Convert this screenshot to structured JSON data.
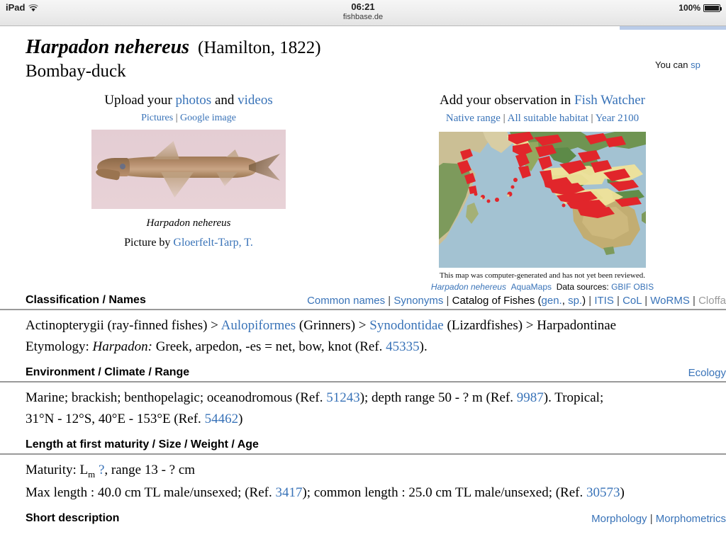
{
  "status_bar": {
    "device": "iPad",
    "wifi_icon": "wifi-icon",
    "time": "06:21",
    "page_domain": "fishbase.de",
    "battery_percent": "100%",
    "battery_icon": "battery-full-icon"
  },
  "notice": {
    "text": "You can sp"
  },
  "header": {
    "scientific_name": "Harpadon nehereus",
    "authority": "(Hamilton, 1822)",
    "common_name": "Bombay-duck"
  },
  "photo_panel": {
    "upload_prefix": "Upload your ",
    "photos_link": "photos",
    "upload_middle": " and ",
    "videos_link": "videos",
    "pictures_link": "Pictures",
    "separator": " | ",
    "google_image_link": "Google image",
    "caption": "Harpadon nehereus",
    "picture_by_prefix": "Picture by ",
    "picture_by_link": "Gloerfelt-Tarp, T."
  },
  "map_panel": {
    "observation_prefix": "Add your observation in ",
    "fish_watcher_link": "Fish Watcher",
    "native_range_link": "Native range",
    "all_habitat_link": "All suitable habitat",
    "year_link": "Year 2100",
    "separator": " | ",
    "map_note": "This map was computer-generated and has not yet been reviewed.",
    "species_link": "Harpadon nehereus",
    "aquamaps_link": "AquaMaps",
    "data_sources_label": "Data sources: ",
    "gbif_obis_link": "GBIF OBIS"
  },
  "sections": [
    {
      "title": "Classification / Names",
      "right_links": [
        {
          "text": "Common names",
          "type": "link"
        },
        {
          "text": " | ",
          "type": "sep"
        },
        {
          "text": "Synonyms",
          "type": "link"
        },
        {
          "text": " | ",
          "type": "sep"
        },
        {
          "text": "Catalog of Fishes ",
          "type": "text"
        },
        {
          "text": "(",
          "type": "text"
        },
        {
          "text": "gen.",
          "type": "link"
        },
        {
          "text": ", ",
          "type": "text"
        },
        {
          "text": "sp.",
          "type": "link"
        },
        {
          "text": ")",
          "type": "text"
        },
        {
          "text": " | ",
          "type": "sep"
        },
        {
          "text": "ITIS",
          "type": "link"
        },
        {
          "text": " | ",
          "type": "sep"
        },
        {
          "text": "CoL",
          "type": "link"
        },
        {
          "text": " | ",
          "type": "sep"
        },
        {
          "text": "WoRMS",
          "type": "link"
        },
        {
          "text": " | ",
          "type": "sep"
        },
        {
          "text": "Cloffa",
          "type": "gray"
        }
      ],
      "lines": [
        [
          {
            "text": "Actinopterygii (ray-finned fishes) > ",
            "type": "text"
          },
          {
            "text": "Aulopiformes",
            "type": "link"
          },
          {
            "text": " (Grinners) > ",
            "type": "text"
          },
          {
            "text": "Synodontidae",
            "type": "link"
          },
          {
            "text": " (Lizardfishes) > Harpadontinae",
            "type": "text"
          }
        ],
        [
          {
            "text": "Etymology: ",
            "type": "text"
          },
          {
            "text": "Harpadon:",
            "type": "italic"
          },
          {
            "text": " Greek, arpedon, -es = net, bow, knot (Ref. ",
            "type": "text"
          },
          {
            "text": "45335",
            "type": "link"
          },
          {
            "text": ").",
            "type": "text"
          }
        ]
      ]
    },
    {
      "title": "Environment / Climate / Range",
      "right_links": [
        {
          "text": "Ecology",
          "type": "link"
        }
      ],
      "lines": [
        [
          {
            "text": "Marine; brackish; benthopelagic; oceanodromous (Ref. ",
            "type": "text"
          },
          {
            "text": "51243",
            "type": "link"
          },
          {
            "text": "); depth range 50 - ? m (Ref. ",
            "type": "text"
          },
          {
            "text": "9987",
            "type": "link"
          },
          {
            "text": ").   Tropical;",
            "type": "text"
          }
        ],
        [
          {
            "text": "31°N - 12°S, 40°E - 153°E (Ref. ",
            "type": "text"
          },
          {
            "text": "54462",
            "type": "link"
          },
          {
            "text": ")",
            "type": "text"
          }
        ]
      ]
    },
    {
      "title": "Length at first maturity / Size / Weight / Age",
      "right_links": [],
      "lines": [
        [
          {
            "text": "Maturity: L",
            "type": "text"
          },
          {
            "text": "m",
            "type": "sub"
          },
          {
            "text": " ",
            "type": "text"
          },
          {
            "text": "?",
            "type": "link"
          },
          {
            "text": ", range 13 - ? cm",
            "type": "text"
          }
        ],
        [
          {
            "text": "Max length : 40.0 cm TL male/unsexed; (Ref. ",
            "type": "text"
          },
          {
            "text": "3417",
            "type": "link"
          },
          {
            "text": "); common length : 25.0 cm TL male/unsexed; (Ref. ",
            "type": "text"
          },
          {
            "text": "30573",
            "type": "link"
          },
          {
            "text": ")",
            "type": "text"
          }
        ]
      ]
    },
    {
      "title": "Short description",
      "right_links": [
        {
          "text": "Morphology",
          "type": "link"
        },
        {
          "text": " | ",
          "type": "sep"
        },
        {
          "text": "Morphometrics",
          "type": "link"
        }
      ],
      "lines": []
    }
  ],
  "colors": {
    "link": "#3973b8",
    "gray_link": "#9a9a9a",
    "rule": "#9a9a9a",
    "notice_bar": "#b9cbe8"
  }
}
